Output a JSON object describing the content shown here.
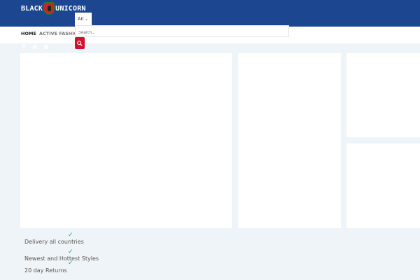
{
  "header": {
    "logo_left": "BLACK",
    "logo_right": "UNICORN",
    "category_select": "All",
    "search_placeholder": "Search..."
  },
  "nav": {
    "items": [
      "HOME",
      "ACTIVE FASHION"
    ]
  },
  "features": [
    "Delivery all countries",
    "Newest and Hottest Styles",
    "20 day Returns"
  ],
  "colors": {
    "header": "#1c4690",
    "accent": "#d4102f",
    "check": "#1fa67a"
  }
}
